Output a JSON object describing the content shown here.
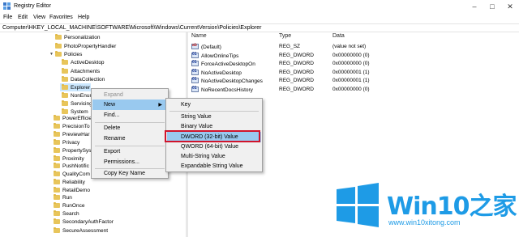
{
  "window": {
    "title": "Registry Editor"
  },
  "menubar": [
    "File",
    "Edit",
    "View",
    "Favorites",
    "Help"
  ],
  "address": "Computer\\HKEY_LOCAL_MACHINE\\SOFTWARE\\Microsoft\\Windows\\CurrentVersion\\Policies\\Explorer",
  "tree": [
    "Personalization",
    "PhotoPropertyHandler",
    "Policies",
    "ActiveDesktop",
    "Attachments",
    "DataCollection",
    "Explorer",
    "NonEnum",
    "Servicing",
    "System",
    "PowerEfficie",
    "PrecisionTo",
    "PreviewHar",
    "Privacy",
    "PropertySys",
    "Proximity",
    "PushNotific",
    "QualityCom",
    "Reliability",
    "RetailDemo",
    "Run",
    "RunOnce",
    "Search",
    "SecondaryAuthFactor",
    "SecureAssessment"
  ],
  "values_header": {
    "name": "Name",
    "type": "Type",
    "data": "Data"
  },
  "values": [
    {
      "icon": "sz",
      "name": "(Default)",
      "type": "REG_SZ",
      "data": "(value not set)"
    },
    {
      "icon": "dw",
      "name": "AllowOnlineTips",
      "type": "REG_DWORD",
      "data": "0x00000000 (0)"
    },
    {
      "icon": "dw",
      "name": "ForceActiveDesktopOn",
      "type": "REG_DWORD",
      "data": "0x00000000 (0)"
    },
    {
      "icon": "dw",
      "name": "NoActiveDesktop",
      "type": "REG_DWORD",
      "data": "0x00000001 (1)"
    },
    {
      "icon": "dw",
      "name": "NoActiveDesktopChanges",
      "type": "REG_DWORD",
      "data": "0x00000001 (1)"
    },
    {
      "icon": "dw",
      "name": "NoRecentDocsHistory",
      "type": "REG_DWORD",
      "data": "0x00000000 (0)"
    }
  ],
  "context_menu": {
    "expand": "Expand",
    "new": "New",
    "find": "Find...",
    "delete": "Delete",
    "rename": "Rename",
    "export": "Export",
    "permissions": "Permissions...",
    "copy_key_name": "Copy Key Name"
  },
  "submenu": {
    "key": "Key",
    "string_value": "String Value",
    "binary_value": "Binary Value",
    "dword_value": "DWORD (32-bit) Value",
    "qword_value": "QWORD (64-bit) Value",
    "multi_string_value": "Multi-String Value",
    "expandable_string_value": "Expandable String Value"
  },
  "watermark": {
    "brand": "Win10",
    "brand_cn": "之家",
    "url": "www.win10xitong.com"
  },
  "colors": {
    "highlight": "#cce8ff",
    "menu_hover": "#99c9ef",
    "callout": "#d0142c",
    "brand": "#1e9be6"
  }
}
